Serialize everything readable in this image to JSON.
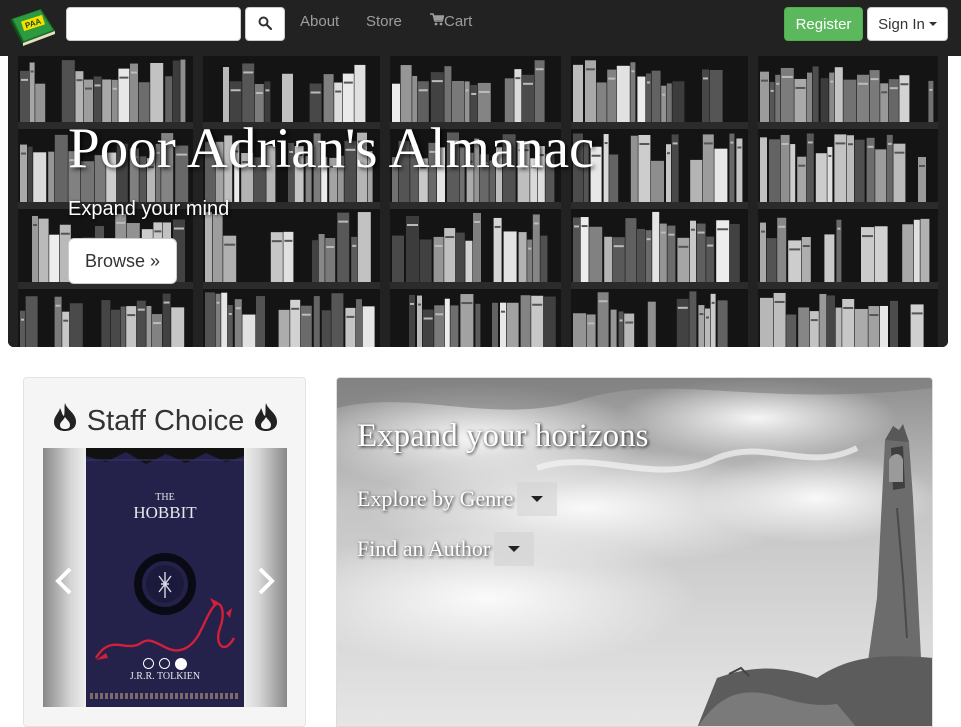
{
  "navbar": {
    "logo_text": "PAA",
    "search": {
      "value": "",
      "placeholder": ""
    },
    "search_icon": "search-icon",
    "links": {
      "about": "About",
      "store": "Store",
      "cart": "Cart"
    },
    "cart_icon": "cart-icon",
    "register_label": "Register",
    "signin_label": "Sign In",
    "colors": {
      "bar": "#222222",
      "link": "#9d9d9d",
      "register": "#5cb85c"
    }
  },
  "hero": {
    "title": "Poor Adrian's Almanac",
    "subtitle": "Expand your mind",
    "browse_label": "Browse »"
  },
  "staff_choice": {
    "title": "Staff Choice",
    "flame_icon": "flame-icon",
    "book": {
      "line1": "THE",
      "line2": "HOBBIT",
      "author": "J.R.R. TOLKIEN"
    },
    "slides": 3,
    "active_slide": 3,
    "prev_icon": "chevron-left-icon",
    "next_icon": "chevron-right-icon"
  },
  "horizons": {
    "title": "Expand your horizons",
    "genre_label": "Explore by Genre",
    "author_label": "Find an Author",
    "dropdown_icon": "caret-down-icon"
  }
}
